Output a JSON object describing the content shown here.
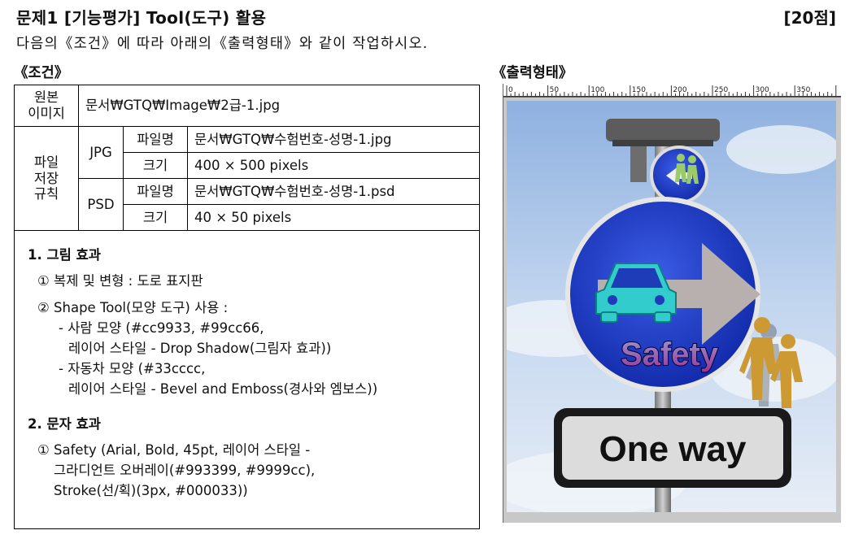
{
  "header": {
    "title": "문제1 [기능평가] Tool(도구) 활용",
    "points": "[20점]",
    "instruction": "다음의《조건》에 따라 아래의《출력형태》와 같이 작업하시오."
  },
  "sections": {
    "conditions_label": "《조건》",
    "output_label": "《출력형태》"
  },
  "conditions": {
    "source": {
      "label": "원본\n이미지",
      "value": "문서₩GTQ₩Image₩2급-1.jpg"
    },
    "save_rule_label": "파일\n저장\n규칙",
    "jpg": {
      "format": "JPG",
      "filename_label": "파일명",
      "filename": "문서₩GTQ₩수험번호-성명-1.jpg",
      "size_label": "크기",
      "size": "400 × 500 pixels"
    },
    "psd": {
      "format": "PSD",
      "filename_label": "파일명",
      "filename": "문서₩GTQ₩수험번호-성명-1.psd",
      "size_label": "크기",
      "size": "40 × 50 pixels"
    }
  },
  "effects": {
    "image_heading": "1. 그림 효과",
    "image_items": [
      "① 복제 및 변형 : 도로 표지판",
      "② Shape Tool(모양 도구) 사용 :",
      "- 사람 모양 (#cc9933, #99cc66,",
      "레이어 스타일 - Drop Shadow(그림자 효과))",
      "- 자동차 모양 (#33cccc,",
      "레이어 스타일 - Bevel and Emboss(경사와 엠보스))"
    ],
    "text_heading": "2. 문자 효과",
    "text_items": [
      "① Safety (Arial, Bold, 45pt, 레이어 스타일 -",
      "그라디언트 오버레이(#993399, #9999cc),",
      "Stroke(선/획)(3px, #000033))"
    ]
  },
  "preview": {
    "ruler_labels": [
      "0",
      "50",
      "100",
      "150",
      "200",
      "250",
      "300",
      "350"
    ],
    "sign_text": "Safety",
    "bottom_sign": "One way",
    "colors": {
      "sign_blue": "#1f3cc7",
      "person_gold": "#cc9933",
      "person_green": "#99cc66",
      "car": "#33cccc",
      "text_grad_start": "#993399",
      "text_grad_end": "#9999cc",
      "stroke": "#000033"
    }
  }
}
